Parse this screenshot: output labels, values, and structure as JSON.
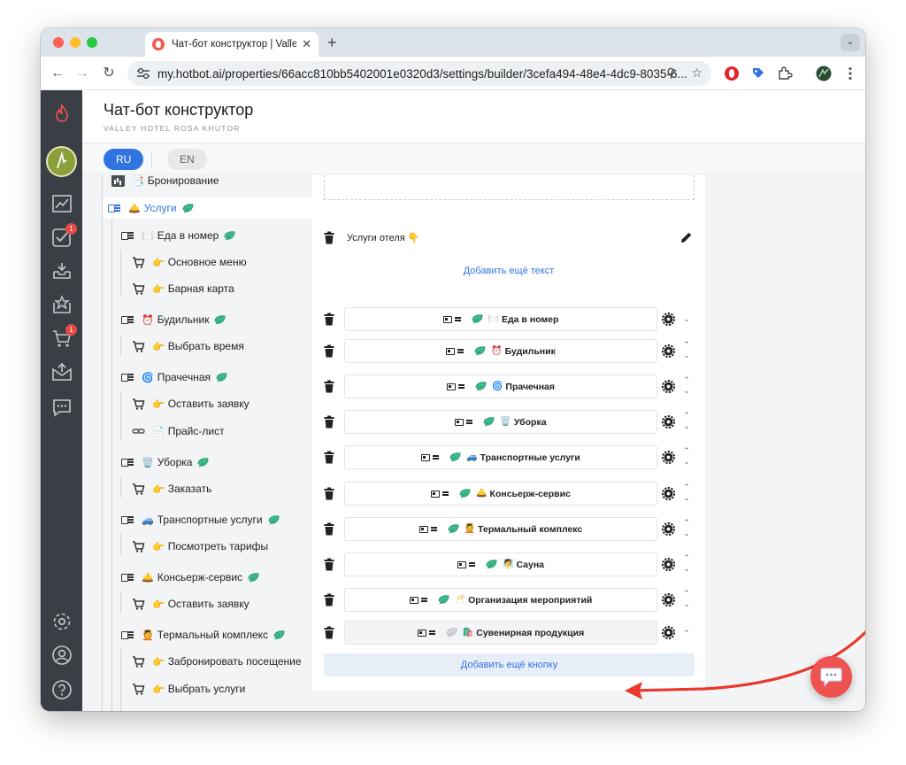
{
  "browser": {
    "tab_title": "Чат-бот конструктор | Valley",
    "tab_close": "✕",
    "new_tab": "+",
    "tab_menu": "⌄",
    "url": "my.hotbot.ai/properties/66acc810bb5402001e0320d3/settings/builder/3cefa494-48e4-4dc9-8035-6...",
    "nav": {
      "back": "←",
      "forward": "→",
      "reload": "↻"
    },
    "omni_icons": {
      "zoom": "⚲",
      "star": "☆"
    }
  },
  "sidebar": {
    "badges": {
      "tasks": "1",
      "cart": "1"
    }
  },
  "header": {
    "title": "Чат-бот конструктор",
    "subtitle": "VALLEY HOTEL ROSA KHUTOR"
  },
  "langs": {
    "active": "RU",
    "inactive": "EN"
  },
  "tree": {
    "booking": {
      "emoji": "📑",
      "label": "Бронирование"
    },
    "services": {
      "emoji": "🛎️",
      "label": "Услуги"
    },
    "food": {
      "emoji": "🍽️",
      "label": "Еда в номер"
    },
    "food_menu": {
      "emoji": "👉",
      "label": "Основное меню"
    },
    "food_bar": {
      "emoji": "👉",
      "label": "Барная карта"
    },
    "alarm": {
      "emoji": "⏰",
      "label": "Будильник"
    },
    "alarm_time": {
      "emoji": "👉",
      "label": "Выбрать время"
    },
    "laundry": {
      "emoji": "🌀",
      "label": "Прачечная"
    },
    "laundry_request": {
      "emoji": "👉",
      "label": "Оставить заявку"
    },
    "laundry_price": {
      "emoji": "📄",
      "label": "Прайс-лист"
    },
    "cleaning": {
      "emoji": "🗑️",
      "label": "Уборка"
    },
    "cleaning_order": {
      "emoji": "👉",
      "label": "Заказать"
    },
    "transport": {
      "emoji": "🚙",
      "label": "Транспортные услуги"
    },
    "transport_rates": {
      "emoji": "👉",
      "label": "Посмотреть тарифы"
    },
    "concierge": {
      "emoji": "🛎️",
      "label": "Консьерж-сервис"
    },
    "concierge_request": {
      "emoji": "👉",
      "label": "Оставить заявку"
    },
    "thermal": {
      "emoji": "💆",
      "label": "Термальный комплекс"
    },
    "thermal_book": {
      "emoji": "👉",
      "label": "Забронировать посещение"
    },
    "thermal_select": {
      "emoji": "👉",
      "label": "Выбрать услуги"
    }
  },
  "panel": {
    "text_block": {
      "label": "Услуги отеля 👇"
    },
    "add_text": "Добавить ещё текст",
    "add_button": "Добавить ещё кнопку",
    "buttons": [
      {
        "emoji": "🍽️",
        "label": "Еда в номер"
      },
      {
        "emoji": "⏰",
        "label": "Будильник"
      },
      {
        "emoji": "🌀",
        "label": "Прачечная"
      },
      {
        "emoji": "🗑️",
        "label": "Уборка"
      },
      {
        "emoji": "🚙",
        "label": "Транспортные услуги"
      },
      {
        "emoji": "🛎️",
        "label": "Консьерж-сервис"
      },
      {
        "emoji": "💆",
        "label": "Термальный комплекс"
      },
      {
        "emoji": "🧖",
        "label": "Сауна"
      },
      {
        "emoji": "🥂",
        "label": "Организация мероприятий"
      },
      {
        "emoji": "🛍️",
        "label": "Сувенирная продукция"
      }
    ]
  },
  "colors": {
    "accent": "#2f74e0",
    "sidebar": "#3a3f45",
    "fab": "#ef5350",
    "arrow": "#e8392c"
  }
}
